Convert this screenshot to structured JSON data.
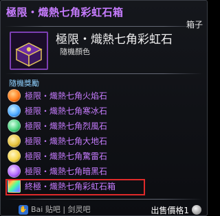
{
  "tooltip": {
    "title": "極限・熾熱七角彩虹石箱",
    "type_label": "箱子",
    "item": {
      "name": "極限・熾熱七角彩虹石",
      "subtitle": "隨機顏色",
      "icon": "purple-treasure-chest-icon"
    },
    "section_label": "隨機獎勵",
    "rewards": [
      {
        "label": "極限・熾熱七角火焰石",
        "icon": "fire-gem-icon",
        "color": "#ff7a1a"
      },
      {
        "label": "極限・熾熱七角寒冰石",
        "icon": "ice-gem-icon",
        "color": "#4aa7ff"
      },
      {
        "label": "極限・熾熱七角烈風石",
        "icon": "wind-gem-icon",
        "color": "#46d07a"
      },
      {
        "label": "極限・熾熱七角大地石",
        "icon": "earth-gem-icon",
        "color": "#e7c23c"
      },
      {
        "label": "極限・熾熱七角驚雷石",
        "icon": "thunder-gem-icon",
        "color": "#f5d447"
      },
      {
        "label": "極限・熾熱七角暗黑石",
        "icon": "dark-gem-icon",
        "color": "#b165ff"
      },
      {
        "label": "終極・熾熱七角彩虹石箱",
        "icon": "rainbow-chest-icon",
        "color": "#8d3ad8"
      }
    ],
    "highlighted_reward_index": 6,
    "footer": {
      "price_label": "出售價格1",
      "watermark": "Bai 贴吧 | 剑灵吧"
    },
    "colors": {
      "title": "#c77cff",
      "reward_text": "#c77cff",
      "highlight_border": "#e02a2a"
    }
  }
}
